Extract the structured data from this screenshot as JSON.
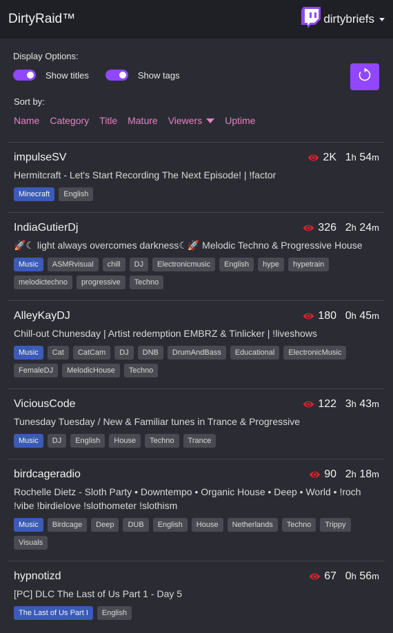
{
  "header": {
    "title": "DirtyRaid™",
    "username": "dirtybriefs"
  },
  "options": {
    "label": "Display Options:",
    "show_titles": "Show titles",
    "show_tags": "Show tags"
  },
  "sort": {
    "label": "Sort by:",
    "name": "Name",
    "category": "Category",
    "title": "Title",
    "mature": "Mature",
    "viewers": "Viewers",
    "uptime": "Uptime"
  },
  "colors": {
    "accent": "#9147ff",
    "link": "#e681c4",
    "eye": "#e0202e",
    "category_tag": "#3b5bb8",
    "tag": "#4a4b52"
  },
  "streams": [
    {
      "name": "impulseSV",
      "viewers": "2K",
      "up_h": "1",
      "up_m": "54",
      "title": "Hermitcraft - Let's Start Recording The Next Episode! | !factor",
      "category": "Minecraft",
      "tags": [
        "English"
      ]
    },
    {
      "name": "IndiaGutierDj",
      "viewers": "326",
      "up_h": "2",
      "up_m": "24",
      "title": "🚀☾ light always overcomes darkness☾🚀 Melodic Techno & Progressive House",
      "category": "Music",
      "tags": [
        "ASMRvisual",
        "chill",
        "DJ",
        "Electronicmusic",
        "English",
        "hype",
        "hypetrain",
        "melodictechno",
        "progressive",
        "Techno"
      ]
    },
    {
      "name": "AlleyKayDJ",
      "viewers": "180",
      "up_h": "0",
      "up_m": "45",
      "title": "Chill-out Chunesday | Artist redemption EMBRZ & Tinlicker | !liveshows",
      "category": "Music",
      "tags": [
        "Cat",
        "CatCam",
        "DJ",
        "DNB",
        "DrumAndBass",
        "Educational",
        "ElectronicMusic",
        "FemaleDJ",
        "MelodicHouse",
        "Techno"
      ]
    },
    {
      "name": "ViciousCode",
      "viewers": "122",
      "up_h": "3",
      "up_m": "43",
      "title": "Tunesday Tuesday / New & Familiar tunes in Trance & Progressive",
      "category": "Music",
      "tags": [
        "DJ",
        "English",
        "House",
        "Techno",
        "Trance"
      ]
    },
    {
      "name": "birdcageradio",
      "viewers": "90",
      "up_h": "2",
      "up_m": "18",
      "title": "Rochelle Dietz - Sloth Party • Downtempo • Organic House • Deep • World • !roch !vibe !birdielove !slothometer !slothism",
      "category": "Music",
      "tags": [
        "Birdcage",
        "Deep",
        "DUB",
        "English",
        "House",
        "Netherlands",
        "Techno",
        "Trippy",
        "Visuals"
      ]
    },
    {
      "name": "hypnotizd",
      "viewers": "67",
      "up_h": "0",
      "up_m": "56",
      "title": "[PC] DLC The Last of Us Part 1 - Day 5",
      "category": "The Last of Us Part I",
      "tags": [
        "English"
      ]
    }
  ]
}
